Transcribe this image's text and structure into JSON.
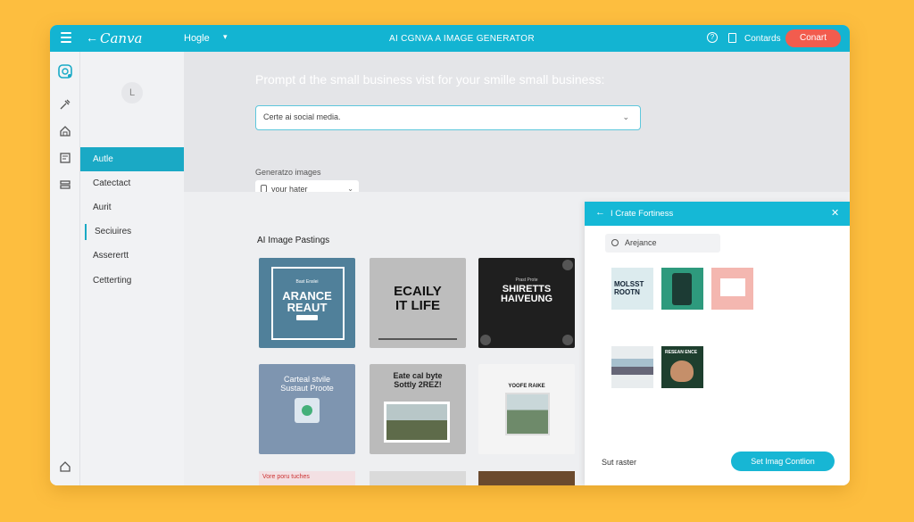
{
  "topbar": {
    "back_icon": "←",
    "logo": "Canva",
    "home_label": "Hogle",
    "title": "AI CGNVA A IMAGE GENERATOR",
    "help_icon": "?",
    "contacts_label": "Contards",
    "contact_button": "Conart"
  },
  "rail_icons": [
    "brand-icon",
    "tools-icon",
    "home-icon",
    "page-icon",
    "layers-icon",
    "house-icon"
  ],
  "sidebar": {
    "avatar_initial": "L",
    "items": [
      {
        "label": "Autle",
        "active": true
      },
      {
        "label": "Catectact",
        "active": false
      },
      {
        "label": "Aurit",
        "active": false
      },
      {
        "label": "Seciuires",
        "active": false
      },
      {
        "label": "Asserertt",
        "active": false
      },
      {
        "label": "Cetterting",
        "active": false
      }
    ]
  },
  "prompt": {
    "heading": "Prompt d the small business vist for your smille small business:",
    "input_value": "Certe ai social media.",
    "chevron": "⌄"
  },
  "generate": {
    "label": "Generatzo images",
    "select_value": "your hater",
    "chevron": "⌄"
  },
  "gallery": {
    "title": "AI Image Pastings",
    "cards": [
      {
        "small": "Bast Enslei",
        "big": "ARANCE REAUT"
      },
      {
        "big": "ECAILY IT LIFE"
      },
      {
        "small": "Prast Prote",
        "big": "SHIRETTS HAIVEUNG"
      },
      {
        "text": "Carteal stvile Sustaut Proote"
      },
      {
        "text": "Eate cal byte Sottly 2REZ!"
      },
      {
        "text": "YOOFE RAIKE"
      }
    ],
    "partial_top_left": "Vore poru tuches"
  },
  "panel": {
    "back_icon": "←",
    "title": "I Crate Fortiness",
    "close_icon": "✕",
    "search_value": "Arejance",
    "thumbs": [
      {
        "text": "MOLSST ROOTN"
      },
      {},
      {},
      {},
      {
        "text": "RESEAN ENCE"
      }
    ],
    "footer_label": "Sut raster",
    "button": "Set Imag Contlion"
  }
}
